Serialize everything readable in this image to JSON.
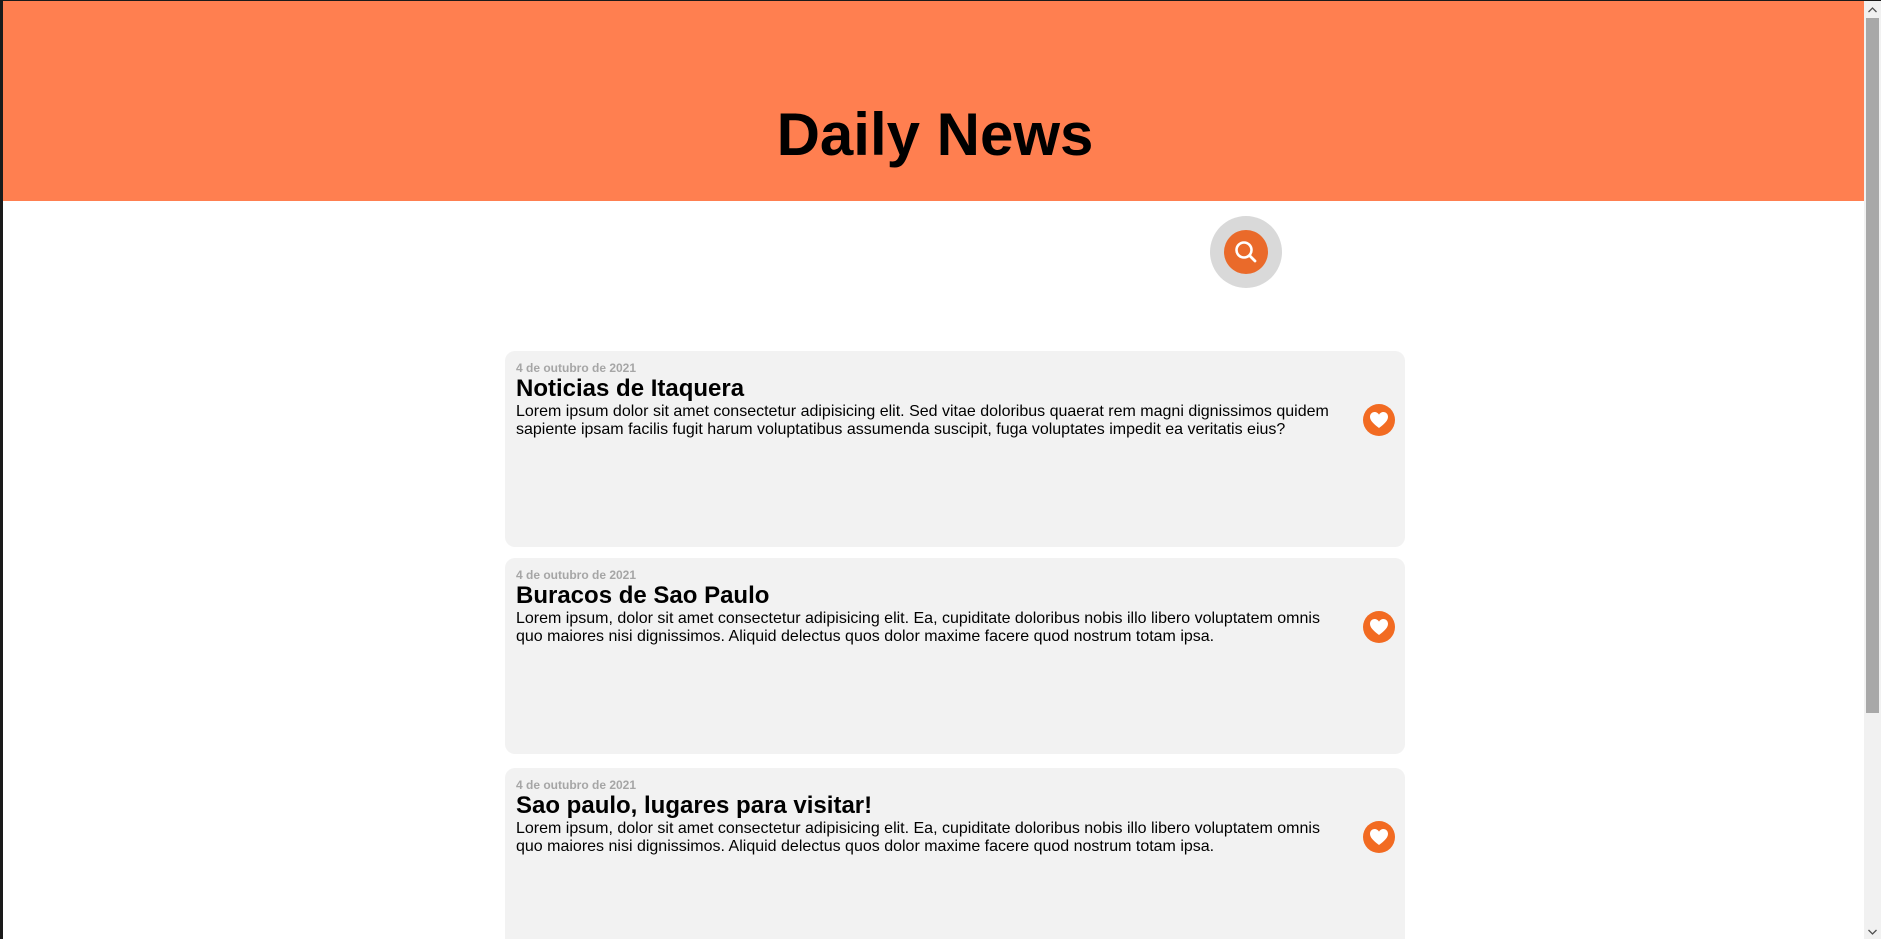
{
  "header": {
    "title": "Daily News",
    "background_color": "#ff7f50"
  },
  "search": {
    "icon": "search-icon",
    "accent_color": "#ea6a2a"
  },
  "articles": [
    {
      "date": "4 de outubro de 2021",
      "title": "Noticias de Itaquera",
      "text": "Lorem ipsum dolor sit amet consectetur adipisicing elit. Sed vitae doloribus quaerat rem magni dignissimos quidem sapiente ipsam facilis fugit harum voluptatibus assumenda suscipit, fuga voluptates impedit ea veritatis eius?",
      "icon": "heart-icon"
    },
    {
      "date": "4 de outubro de 2021",
      "title": "Buracos de Sao Paulo",
      "text": "Lorem ipsum, dolor sit amet consectetur adipisicing elit. Ea, cupiditate doloribus nobis illo libero voluptatem omnis quo maiores nisi dignissimos. Aliquid delectus quos dolor maxime facere quod nostrum totam ipsa.",
      "icon": "heart-icon"
    },
    {
      "date": "4 de outubro de 2021",
      "title": "Sao paulo, lugares para visitar!",
      "text": "Lorem ipsum, dolor sit amet consectetur adipisicing elit. Ea, cupiditate doloribus nobis illo libero voluptatem omnis quo maiores nisi dignissimos. Aliquid delectus quos dolor maxime facere quod nostrum totam ipsa.",
      "icon": "heart-icon"
    }
  ],
  "colors": {
    "card_background": "#f2f2f2",
    "date_text": "#a6a6a6",
    "heart": "#f26b22"
  }
}
